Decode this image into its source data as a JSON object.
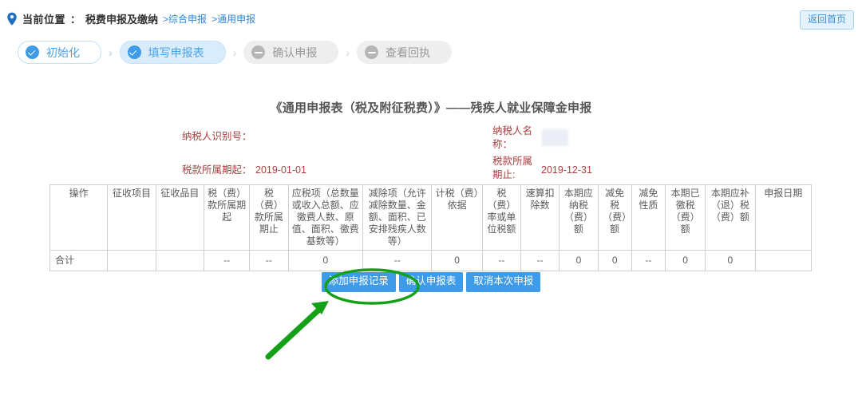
{
  "breadcrumb": {
    "pin_icon": "location-pin-icon",
    "label": "当前位置",
    "separator": "：",
    "root": "税费申报及缴纳",
    "links": [
      {
        "text": ">综合申报"
      },
      {
        "text": ">通用申报"
      }
    ]
  },
  "header": {
    "return_home_label": "返回首页"
  },
  "steps": [
    {
      "label": "初始化",
      "state": "done",
      "icon": "check-circle-icon"
    },
    {
      "label": "填写申报表",
      "state": "current",
      "icon": "check-circle-icon"
    },
    {
      "label": "确认申报",
      "state": "todo",
      "icon": "minus-circle-icon"
    },
    {
      "label": "查看回执",
      "state": "todo",
      "icon": "minus-circle-icon"
    }
  ],
  "step_arrow": "›",
  "form": {
    "title": "《通用申报表（税及附征税费）》——残疾人就业保障金申报",
    "taxpayer_id_label": "纳税人识别号：",
    "taxpayer_id_value": "",
    "taxpayer_name_label": "纳税人名称：",
    "taxpayer_name_value": "",
    "period_start_label": "税款所属期起：",
    "period_start_value": "2019-01-01",
    "period_end_label": "税款所属期止:",
    "period_end_value": "2019-12-31"
  },
  "table": {
    "columns": [
      "操作",
      "征收项目",
      "征收品目",
      "税（费）款所属期起",
      "税（费）款所属期止",
      "应税项（总数量或收入总额、应徼费人数、原值、面积、徼费基数等）",
      "减除项（允许减除数量、金额、面积、已安排残疾人数等）",
      "计税（费）依据",
      "税（费）率或单位税额",
      "速算扣除数",
      "本期应纳税（费）额",
      "减免税（费）额",
      "减免性质",
      "本期已徼税（费）额",
      "本期应补（退）税（费）额",
      "申报日期"
    ],
    "rows": [
      [
        "合计",
        "",
        "",
        "--",
        "--",
        "0",
        "--",
        "0",
        "--",
        "--",
        "0",
        "0",
        "--",
        "0",
        "0",
        ""
      ]
    ]
  },
  "actions": [
    {
      "label": "添加申报记录",
      "name": "add-declaration-record-button",
      "highlighted": true
    },
    {
      "label": "确认申报表",
      "name": "confirm-declaration-button",
      "highlighted": false
    },
    {
      "label": "取消本次申报",
      "name": "cancel-declaration-button",
      "highlighted": false
    }
  ],
  "annotation": {
    "color": "#15a117",
    "ellipse_target": "添加申报记录",
    "arrow": "points-up-right"
  },
  "colors": {
    "accent_blue": "#3d9be9",
    "link_blue": "#2f86d6",
    "meta_red": "#a8403f",
    "annotation_green": "#15a117",
    "step_gray": "#b5b5b5"
  }
}
